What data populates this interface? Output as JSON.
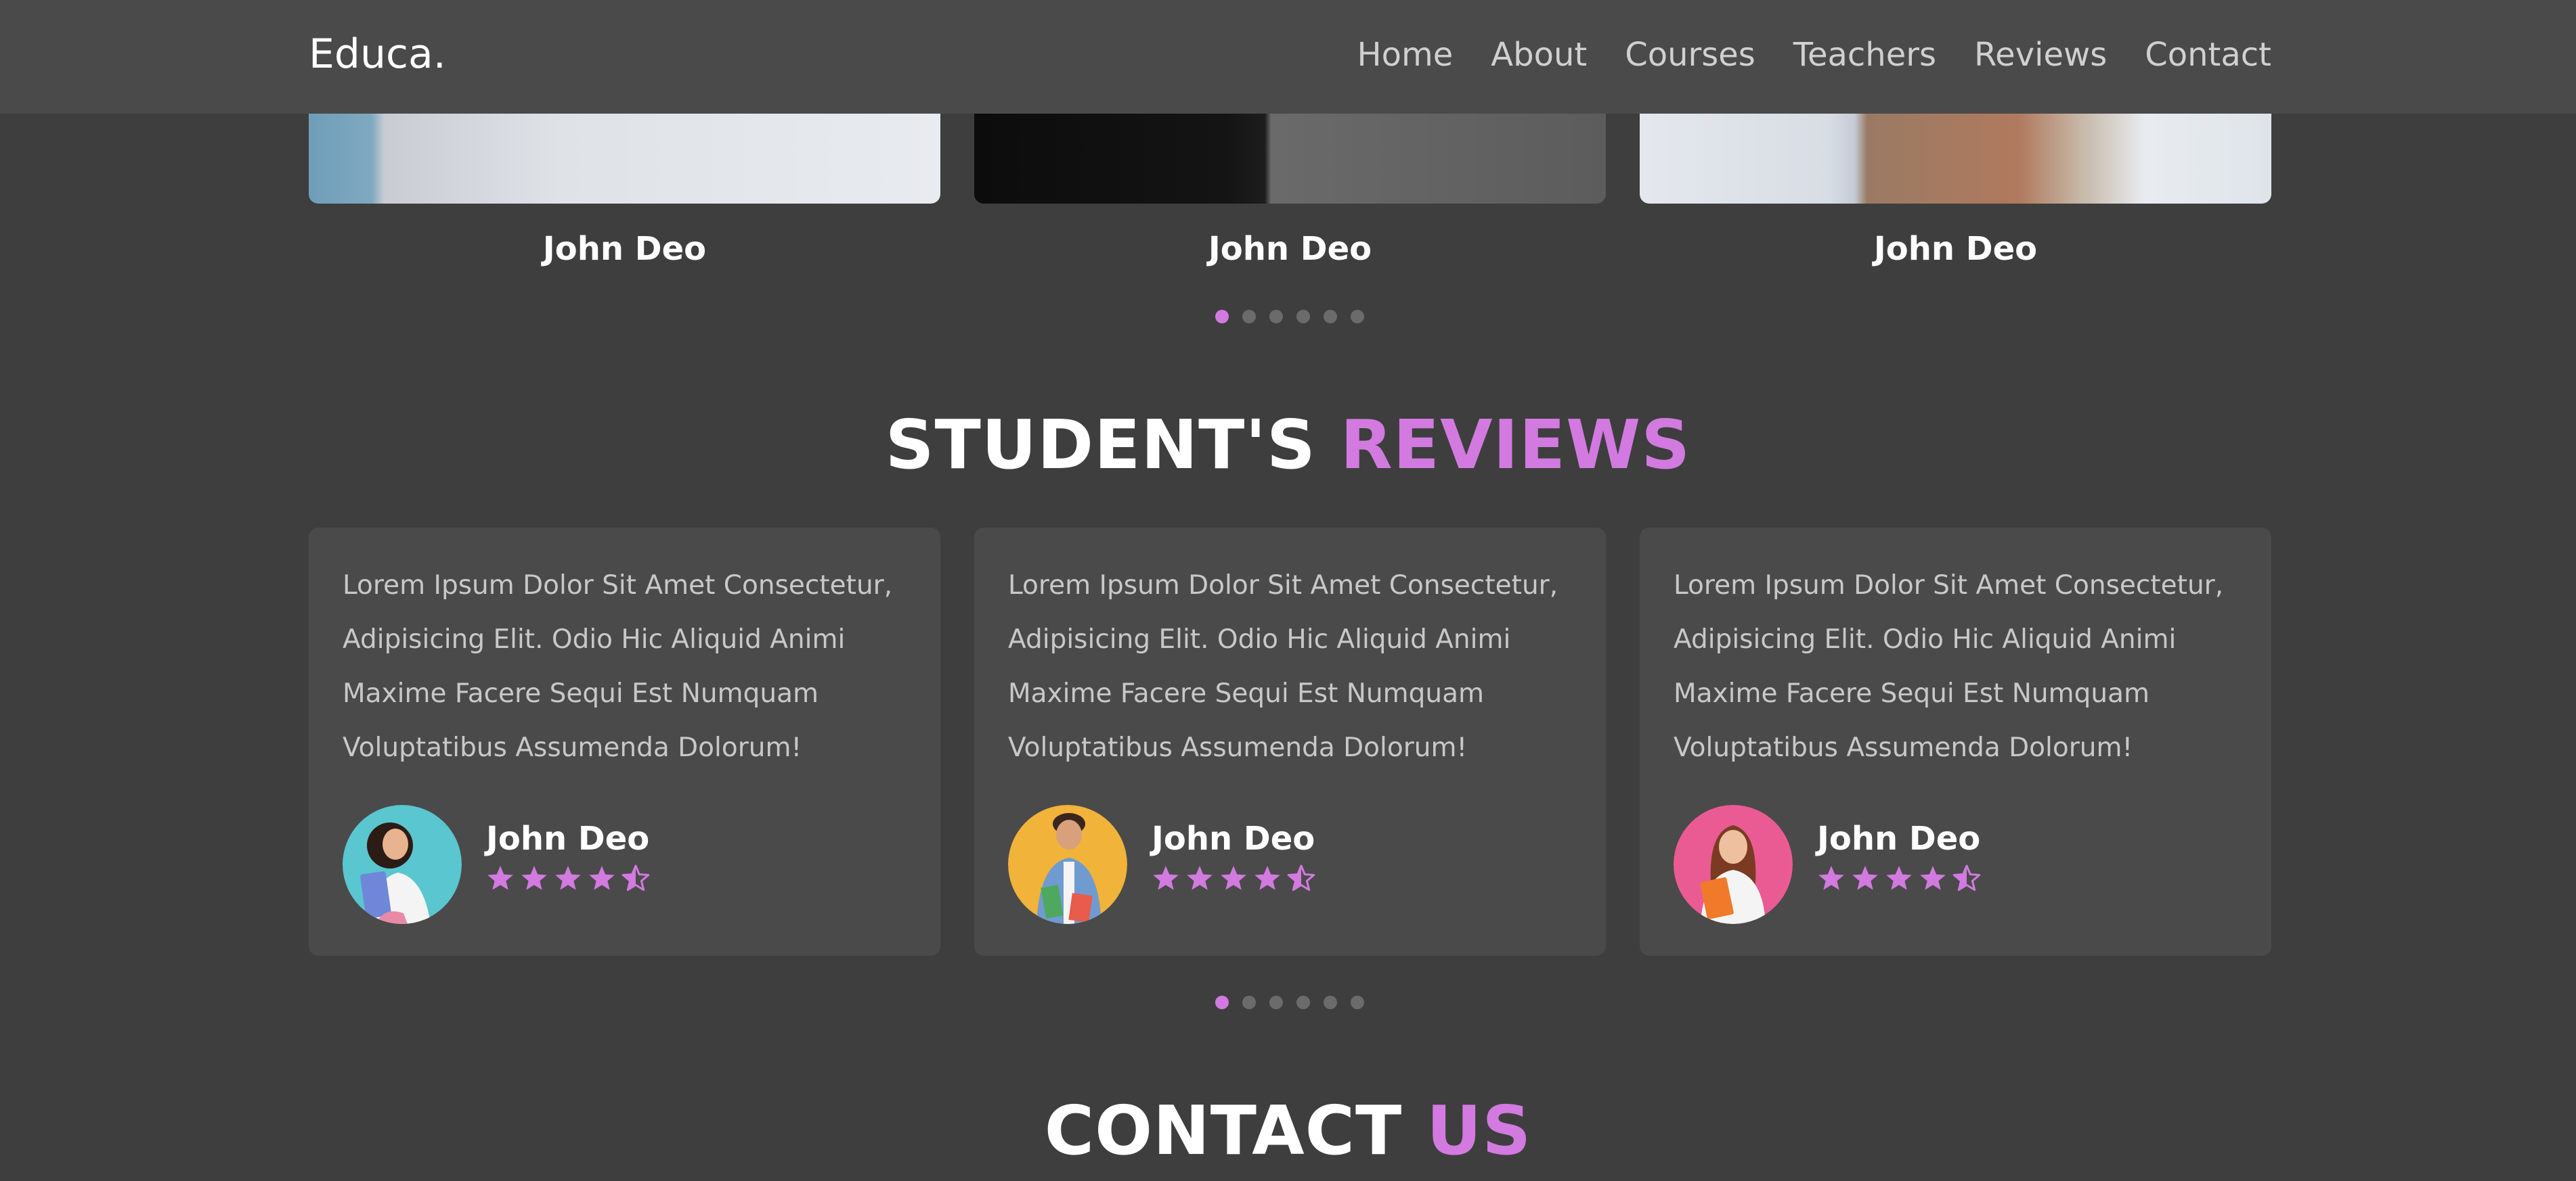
{
  "header": {
    "logo": "Educa.",
    "nav": [
      "Home",
      "About",
      "Courses",
      "Teachers",
      "Reviews",
      "Contact"
    ]
  },
  "teachers": [
    {
      "name": "John Deo"
    },
    {
      "name": "John Deo"
    },
    {
      "name": "John Deo"
    }
  ],
  "teachers_pager": {
    "count": 6,
    "active": 0
  },
  "reviews_section": {
    "title_main": "STUDENT'S",
    "title_accent": "REVIEWS"
  },
  "reviews": [
    {
      "lines": [
        "Lorem Ipsum Dolor Sit Amet Consectetur,",
        "Adipisicing Elit. Odio Hic Aliquid Animi",
        "Maxime Facere Sequi Est Numquam",
        "Voluptatibus Assumenda Dolorum!"
      ],
      "name": "John Deo",
      "rating": 4.5,
      "avatar_bg": "#5ac6cf"
    },
    {
      "lines": [
        "Lorem Ipsum Dolor Sit Amet Consectetur,",
        "Adipisicing Elit. Odio Hic Aliquid Animi",
        "Maxime Facere Sequi Est Numquam",
        "Voluptatibus Assumenda Dolorum!"
      ],
      "name": "John Deo",
      "rating": 4.5,
      "avatar_bg": "#f1b33a"
    },
    {
      "lines": [
        "Lorem Ipsum Dolor Sit Amet Consectetur,",
        "Adipisicing Elit. Odio Hic Aliquid Animi",
        "Maxime Facere Sequi Est Numquam",
        "Voluptatibus Assumenda Dolorum!"
      ],
      "name": "John Deo",
      "rating": 4.5,
      "avatar_bg": "#ea5b94"
    }
  ],
  "reviews_pager": {
    "count": 6,
    "active": 0
  },
  "contact_section": {
    "title_main": "CONTACT",
    "title_accent": "US"
  },
  "colors": {
    "accent": "#d27ae0",
    "background": "#3e3e3e",
    "card": "#4a4a4a"
  }
}
